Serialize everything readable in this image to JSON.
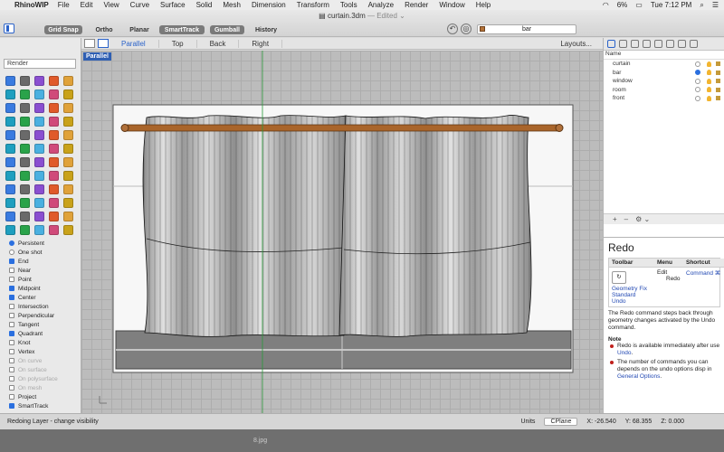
{
  "menubar": {
    "apple": "",
    "app": "RhinoWIP",
    "items": [
      "File",
      "Edit",
      "View",
      "Curve",
      "Surface",
      "Solid",
      "Mesh",
      "Dimension",
      "Transform",
      "Tools",
      "Analyze",
      "Render",
      "Window",
      "Help"
    ],
    "battery": "6%",
    "clock": "Tue 7:12 PM"
  },
  "window": {
    "title": "curtain.3dm",
    "edited": "— Edited ⌄",
    "modes": [
      "Grid Snap",
      "Ortho",
      "Planar",
      "SmartTrack",
      "Gumball",
      "History"
    ],
    "current_layer": "bar",
    "current_layer_color": "#b4743a"
  },
  "viewport_tabs": {
    "tabs": [
      "Parallel",
      "Top",
      "Back",
      "Right"
    ],
    "active": "Parallel",
    "layouts": "Layouts..."
  },
  "viewport": {
    "label": "Parallel"
  },
  "command": {
    "value": "Render"
  },
  "osnap": {
    "modes": [
      {
        "label": "Persistent",
        "type": "radio",
        "on": true
      },
      {
        "label": "One shot",
        "type": "radio",
        "on": false
      },
      {
        "label": "End",
        "on": true
      },
      {
        "label": "Near",
        "on": false
      },
      {
        "label": "Point",
        "on": false
      },
      {
        "label": "Midpoint",
        "on": true
      },
      {
        "label": "Center",
        "on": true
      },
      {
        "label": "Intersection",
        "on": false
      },
      {
        "label": "Perpendicular",
        "on": false
      },
      {
        "label": "Tangent",
        "on": false
      },
      {
        "label": "Quadrant",
        "on": true
      },
      {
        "label": "Knot",
        "on": false
      },
      {
        "label": "Vertex",
        "on": false
      },
      {
        "label": "On curve",
        "on": false,
        "disabled": true
      },
      {
        "label": "On surface",
        "on": false,
        "disabled": true
      },
      {
        "label": "On polysurface",
        "on": false,
        "disabled": true
      },
      {
        "label": "On mesh",
        "on": false,
        "disabled": true
      },
      {
        "label": "Project",
        "on": false
      },
      {
        "label": "SmartTrack",
        "on": true
      }
    ]
  },
  "layers": {
    "header": "Name",
    "items": [
      {
        "name": "curtain",
        "current": false
      },
      {
        "name": "bar",
        "current": true
      },
      {
        "name": "window",
        "current": false
      },
      {
        "name": "room",
        "current": false
      },
      {
        "name": "front",
        "current": false
      }
    ],
    "footer_add": "+",
    "footer_remove": "–",
    "footer_gear": "⚙ ⌄"
  },
  "help": {
    "title": "Redo",
    "table_headers": [
      "Toolbar",
      "Menu",
      "Shortcut"
    ],
    "toolbar_links": [
      "Geometry Fix",
      "Standard",
      "Undo"
    ],
    "menu": "Edit",
    "menu_sub": "Redo",
    "shortcut": "Command ⌘",
    "desc": "The Redo command steps back through geometry changes activated by the Undo command.",
    "note_title": "Note",
    "notes": [
      {
        "text": "Redo is available immediately after use ",
        "link": "Undo",
        "tail": "."
      },
      {
        "text": "The number of commands you can depends on the undo options disp in ",
        "link": "General Options",
        "tail": "."
      }
    ]
  },
  "status": {
    "message": "Redoing Layer - change visibility",
    "units": "Units",
    "cplane": "CPlane",
    "x": "X: -26.540",
    "y": "Y: 68.355",
    "z": "Z: 0.000"
  },
  "dock": {
    "file": "8.jpg"
  }
}
